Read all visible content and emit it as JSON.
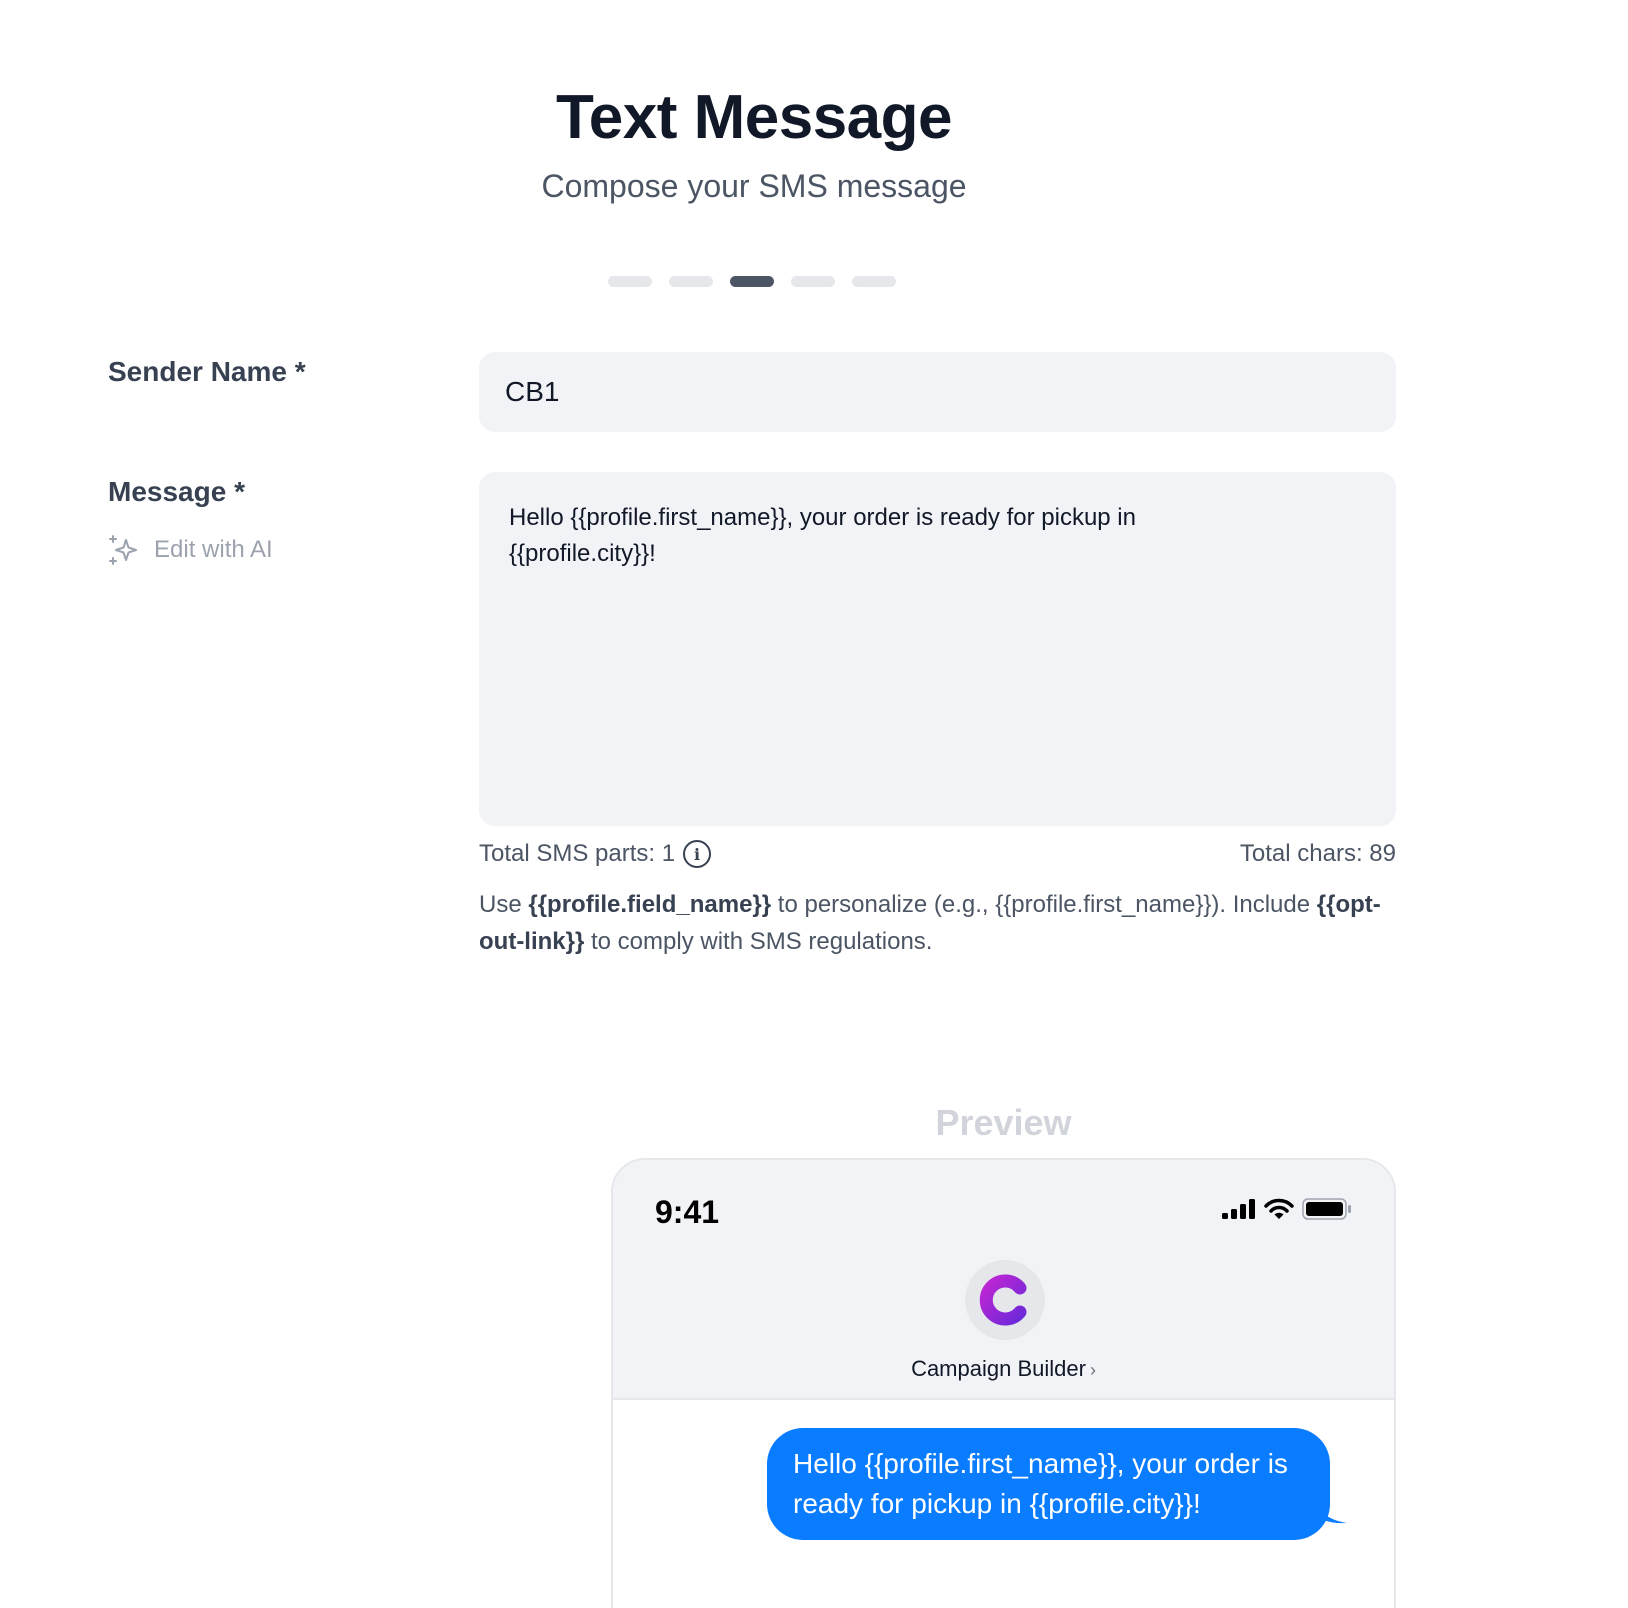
{
  "header": {
    "title": "Text Message",
    "subtitle": "Compose your SMS message"
  },
  "steps": {
    "count": 5,
    "active_index": 2
  },
  "form": {
    "sender_label": "Sender Name *",
    "sender_value": "CB1",
    "message_label": "Message *",
    "ai_button_label": "Edit with AI",
    "message_value": "Hello {{profile.first_name}}, your order is ready for pickup in\n{{profile.city}}!",
    "sms_parts_label": "Total SMS parts: 1",
    "total_chars_label": "Total chars: 89",
    "help": {
      "use": "Use",
      "field_token": "{{profile.field_name}}",
      "personalize": "to personalize (e.g., {{profile.first_name}}). Include",
      "optout_token": "{{opt-out-link}}",
      "comply": "to comply with SMS regulations."
    }
  },
  "preview": {
    "label": "Preview",
    "status_time": "9:41",
    "contact_name": "Campaign Builder",
    "bubble_text": "Hello {{profile.first_name}}, your order is ready for pickup in {{profile.city}}!"
  },
  "icons": {
    "ai": "sparkles-icon",
    "info": "info-icon",
    "signal": "cellular-signal-icon",
    "wifi": "wifi-icon",
    "battery": "battery-icon",
    "chevron": "chevron-right-icon"
  },
  "colors": {
    "bubble": "#0a7cff",
    "active_step": "#4b5563",
    "input_bg": "#f2f3f7",
    "avatar_gradient_start": "#c026d3",
    "avatar_gradient_end": "#6d28d9"
  }
}
